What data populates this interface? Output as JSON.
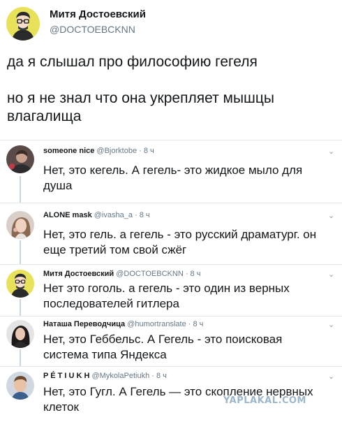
{
  "main_tweet": {
    "name": "Митя Достоевский",
    "handle": "@DOCTOEBCKNN",
    "text": "да я слышал про философию гегеля\n\nно я не знал что она укрепляет мышцы влагалища",
    "avatar_icon": "cartoon-man-glasses-avatar"
  },
  "replies": [
    {
      "name": "someone nice",
      "meta": "@Bjorktobe · 8 ч",
      "text": "Нет, это кегель. А гегель- это жидкое мыло для душа",
      "avatar_icon": "person-photo-avatar"
    },
    {
      "name": "ALONE mask",
      "meta": "@ivasha_a · 8 ч",
      "text": "Нет, это гель. а гегель - это русский драматург. он еще третий том свой сжёг",
      "avatar_icon": "girl-photo-avatar"
    },
    {
      "name": "Митя Достоевский",
      "meta": "@DOCTOEBCKNN · 8 ч",
      "text": "Нет это гоголь. а гегель - это один из верных последователей гитлера",
      "avatar_icon": "cartoon-man-glasses-avatar"
    },
    {
      "name": "Наташа Переводчица",
      "meta": "@humortranslate · 8 ч",
      "text": "Нет, это Геббельс. А Гегель - это поисковая система типа Яндекса",
      "avatar_icon": "woman-photo-avatar"
    },
    {
      "name": "P É T I U K H",
      "meta": "@MykolaPetiukh · 8 ч",
      "text": "Нет, это Гугл. А Гегель — это скопление нервных клеток",
      "avatar_icon": "boy-photo-avatar"
    }
  ],
  "watermark": "YAPLAKAL.COM",
  "colors": {
    "text": "#14171a",
    "meta": "#657786",
    "divider": "#e1e8ed",
    "thread_line": "#ccd6dd"
  }
}
